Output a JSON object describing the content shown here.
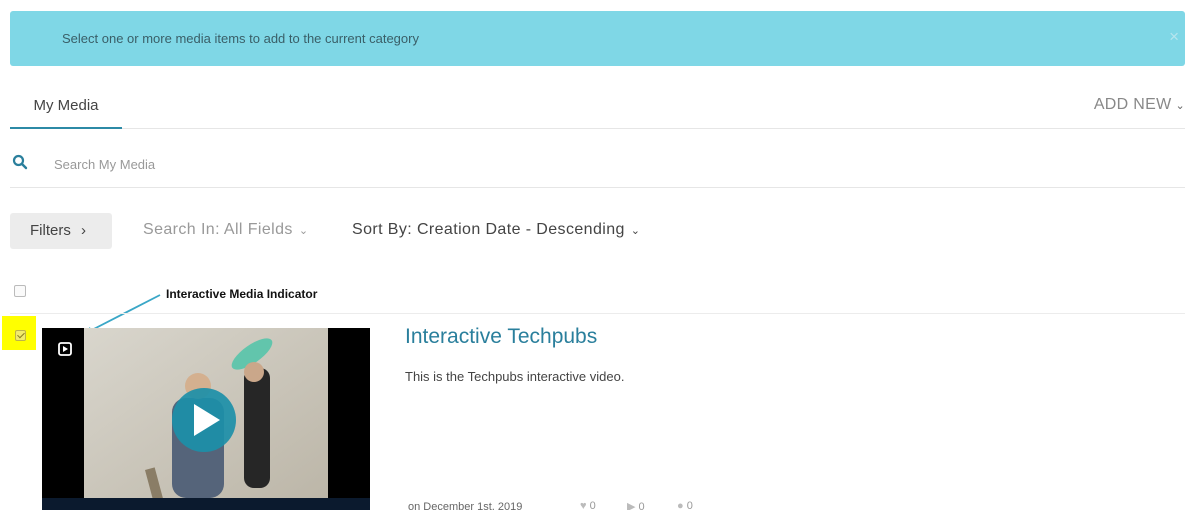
{
  "alert": {
    "message": "Select one or more media items to add to the current category",
    "close": "×"
  },
  "tabs": {
    "my_media": "My Media",
    "add_new": "ADD NEW",
    "add_new_chevron": "⌄"
  },
  "search": {
    "placeholder": "Search My Media",
    "icon": "search-icon"
  },
  "toolbar": {
    "filters": "Filters",
    "filters_chevron": "›",
    "search_in": "Search In: All Fields",
    "sort_by": "Sort By: Creation Date - Descending",
    "chevron": "⌄"
  },
  "annotation": {
    "label": "Interactive Media Indicator"
  },
  "media": [
    {
      "title": "Interactive Techpubs",
      "description": "This is the Techpubs interactive video.",
      "date": "on December 1st, 2019",
      "likes": "0",
      "plays": "0",
      "comments": "0",
      "selected": true
    }
  ],
  "colors": {
    "alert_bg": "#7fd7e6",
    "accent": "#2a7f9c",
    "highlight": "#ffff00"
  }
}
